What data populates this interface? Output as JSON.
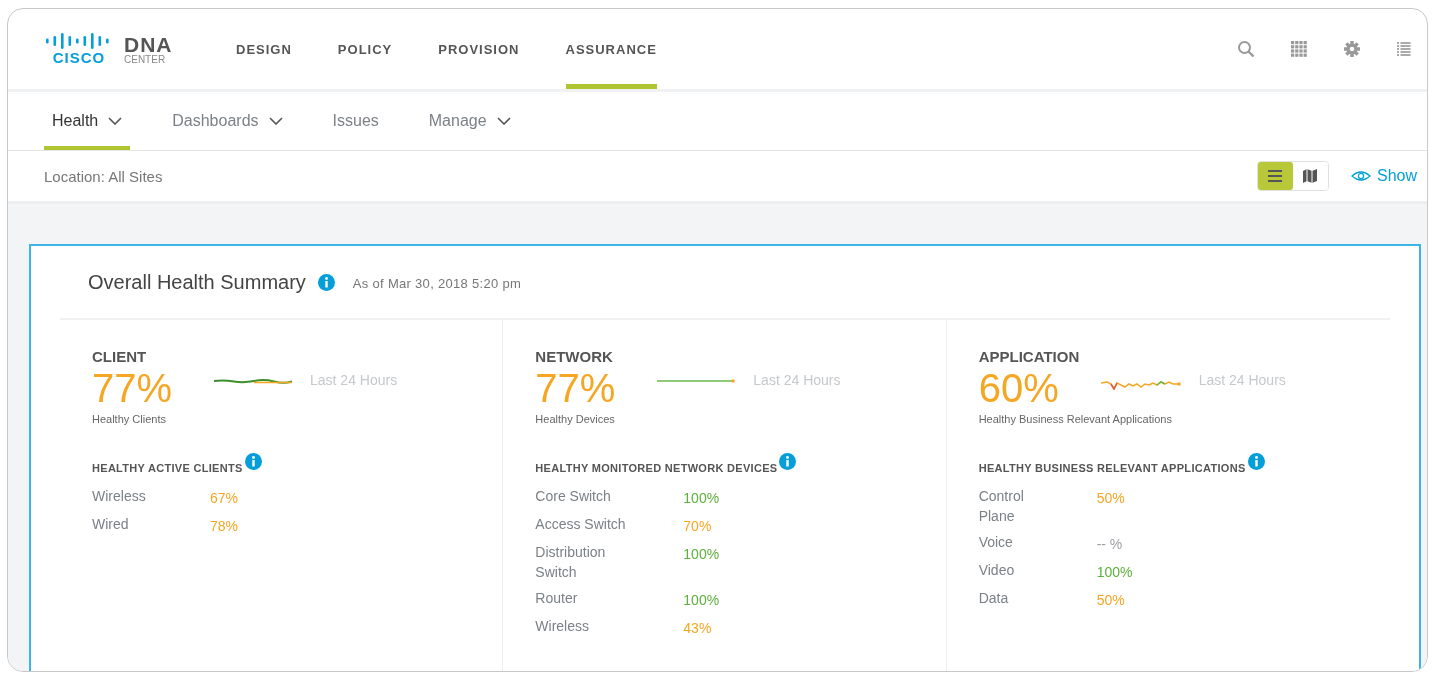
{
  "logo": {
    "brand": "CISCO",
    "product": "DNA",
    "subtitle": "CENTER"
  },
  "nav": [
    {
      "label": "DESIGN",
      "selected": false
    },
    {
      "label": "POLICY",
      "selected": false
    },
    {
      "label": "PROVISION",
      "selected": false
    },
    {
      "label": "ASSURANCE",
      "selected": true
    }
  ],
  "subnav": [
    {
      "label": "Health",
      "selected": true,
      "dropdown": true
    },
    {
      "label": "Dashboards",
      "selected": false,
      "dropdown": true
    },
    {
      "label": "Issues",
      "selected": false,
      "dropdown": false
    },
    {
      "label": "Manage",
      "selected": false,
      "dropdown": true
    }
  ],
  "location": "Location: All Sites",
  "view_toggle": [
    {
      "kind": "list",
      "selected": true
    },
    {
      "kind": "map",
      "selected": false
    }
  ],
  "show_link": "Show",
  "summary": {
    "title": "Overall Health Summary",
    "timestamp": "As of Mar 30, 2018 5:20 pm",
    "sections": [
      {
        "heading": "CLIENT",
        "score": "77%",
        "kind": "flat",
        "period": "Last 24 Hours",
        "caption": "Healthy Clients",
        "subheading": "HEALTHY ACTIVE CLIENTS",
        "rows": [
          {
            "label": "Wireless",
            "value": "67%",
            "color": "#f5a623"
          },
          {
            "label": "Wired",
            "value": "78%",
            "color": "#f5a623"
          }
        ]
      },
      {
        "heading": "NETWORK",
        "score": "77%",
        "kind": "line",
        "period": "Last 24 Hours",
        "caption": "Healthy Devices",
        "subheading": "HEALTHY MONITORED NETWORK DEVICES",
        "rows": [
          {
            "label": "Core Switch",
            "value": "100%",
            "color": "#5cb03c"
          },
          {
            "label": "Access Switch",
            "value": "70%",
            "color": "#f5a623"
          },
          {
            "label": "Distribution Switch",
            "value": "100%",
            "color": "#5cb03c"
          },
          {
            "label": "Router",
            "value": "100%",
            "color": "#5cb03c"
          },
          {
            "label": "Wireless",
            "value": "43%",
            "color": "#f5a623"
          }
        ]
      },
      {
        "heading": "APPLICATION",
        "score": "60%",
        "kind": "wavy",
        "period": "Last 24 Hours",
        "caption": "Healthy Business Relevant Applications",
        "subheading": "HEALTHY BUSINESS RELEVANT APPLICATIONS",
        "rows": [
          {
            "label": "Control Plane",
            "value": "50%",
            "color": "#f5a623"
          },
          {
            "label": "Voice",
            "value": "-- %",
            "color": "#9a9ea3"
          },
          {
            "label": "Video",
            "value": "100%",
            "color": "#5cb03c"
          },
          {
            "label": "Data",
            "value": "50%",
            "color": "#f5a623"
          }
        ]
      }
    ]
  }
}
